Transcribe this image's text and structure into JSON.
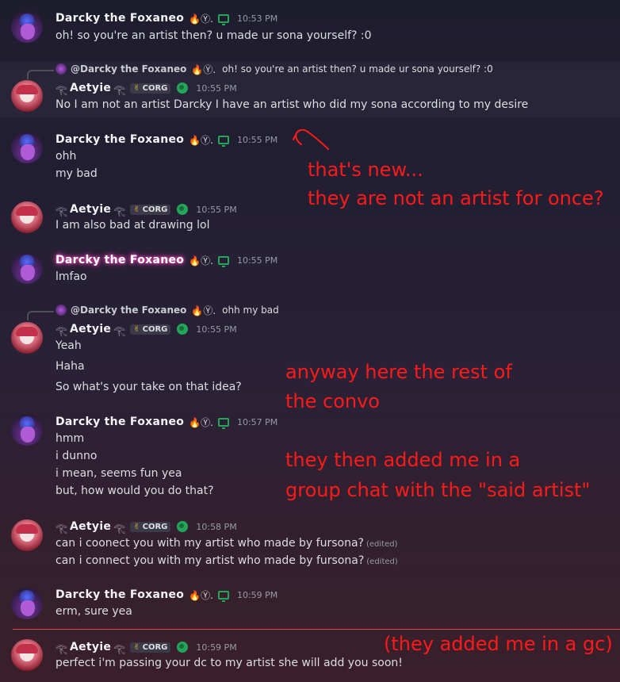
{
  "users": {
    "darcky": {
      "name": "Darcky the Foxaneo",
      "badges": "🔥Ⓨ."
    },
    "aetyie": {
      "name": "Aetyie",
      "tag": "CORG"
    }
  },
  "messages": [
    {
      "time": "10:53 PM",
      "lines": [
        "oh! so you're an artist then? u made ur sona yourself? :0"
      ]
    },
    {
      "reply_name": "@Darcky the Foxaneo",
      "reply_text": "oh! so you're an artist then? u made ur sona yourself? :0",
      "time": "10:55 PM",
      "lines": [
        "No I am not an artist Darcky I have an artist who did my sona according to my desire"
      ]
    },
    {
      "time": "10:55 PM",
      "lines": [
        "ohh",
        "my bad"
      ]
    },
    {
      "time": "10:55 PM",
      "lines": [
        "I am also bad at drawing lol"
      ]
    },
    {
      "time": "10:55 PM",
      "lines": [
        "lmfao"
      ]
    },
    {
      "reply_name": "@Darcky the Foxaneo",
      "reply_text": "ohh my bad",
      "time": "10:55 PM",
      "lines": [
        "Yeah",
        "Haha",
        "So what's your take on that idea?"
      ]
    },
    {
      "time": "10:57 PM",
      "lines": [
        "hmm",
        "i dunno",
        "i mean, seems fun yea",
        "but, how would you do that?"
      ]
    },
    {
      "time": "10:58 PM",
      "lines": [
        "can i coonect you with my artist who made by fursona?",
        "can i connect you with my artist who made by fursona?"
      ],
      "edited": "(edited)"
    },
    {
      "time": "10:59 PM",
      "lines": [
        "erm, sure yea"
      ]
    },
    {
      "time": "10:59 PM",
      "lines": [
        "perfect i'm passing your dc to my artist she will add you soon!"
      ]
    }
  ],
  "annotations": {
    "a1": "that's new...",
    "a2": "they are not an artist for once?",
    "a3": "anyway here the rest of",
    "a4": "the convo",
    "a5": "they then added me in a",
    "a6": "group chat with the \"said artist\"",
    "a7": "(they added me in a gc)"
  },
  "colors": {
    "annotation": "#ff1a1a",
    "status_online": "#23a55a",
    "new_divider": "#e0454f"
  }
}
